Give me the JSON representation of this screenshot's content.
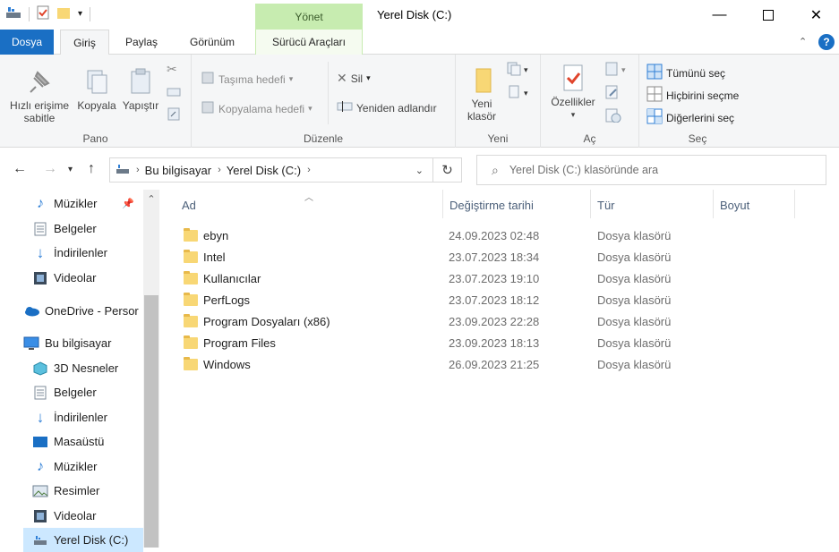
{
  "window": {
    "title": "Yerel Disk (C:)",
    "contextual_tab": "Yönet"
  },
  "tabs": {
    "file": "Dosya",
    "home": "Giriş",
    "share": "Paylaş",
    "view": "Görünüm",
    "drive_tools": "Sürücü Araçları"
  },
  "ribbon": {
    "pano": {
      "label": "Pano",
      "pin": "Hızlı erişime sabitle",
      "copy": "Kopyala",
      "paste": "Yapıştır"
    },
    "duzenle": {
      "label": "Düzenle",
      "move_to": "Taşıma hedefi",
      "copy_to": "Kopyalama hedefi",
      "delete": "Sil",
      "rename": "Yeniden adlandır"
    },
    "yeni": {
      "label": "Yeni",
      "new_folder": "Yeni klasör"
    },
    "ac": {
      "label": "Aç",
      "properties": "Özellikler"
    },
    "sec": {
      "label": "Seç",
      "select_all": "Tümünü seç",
      "select_none": "Hiçbirini seçme",
      "invert": "Diğerlerini seç"
    }
  },
  "address": {
    "crumbs": [
      "Bu bilgisayar",
      "Yerel Disk (C:)"
    ],
    "search_placeholder": "Yerel Disk (C:) klasöründe ara"
  },
  "sidebar": {
    "items": [
      {
        "label": "Müzikler",
        "icon": "music-icon"
      },
      {
        "label": "Belgeler",
        "icon": "document-icon"
      },
      {
        "label": "İndirilenler",
        "icon": "download-icon"
      },
      {
        "label": "Videolar",
        "icon": "video-icon"
      },
      {
        "label": "OneDrive - Persor",
        "icon": "cloud-icon"
      },
      {
        "label": "Bu bilgisayar",
        "icon": "computer-icon"
      },
      {
        "label": "3D Nesneler",
        "icon": "cube-icon"
      },
      {
        "label": "Belgeler",
        "icon": "document-icon"
      },
      {
        "label": "İndirilenler",
        "icon": "download-icon"
      },
      {
        "label": "Masaüstü",
        "icon": "desktop-icon"
      },
      {
        "label": "Müzikler",
        "icon": "music-icon"
      },
      {
        "label": "Resimler",
        "icon": "pictures-icon"
      },
      {
        "label": "Videolar",
        "icon": "video-icon"
      },
      {
        "label": "Yerel Disk (C:)",
        "icon": "drive-icon"
      }
    ]
  },
  "columns": {
    "name": "Ad",
    "date": "Değiştirme tarihi",
    "type": "Tür",
    "size": "Boyut"
  },
  "files": [
    {
      "name": "ebyn",
      "date": "24.09.2023 02:48",
      "type": "Dosya klasörü"
    },
    {
      "name": "Intel",
      "date": "23.07.2023 18:34",
      "type": "Dosya klasörü"
    },
    {
      "name": "Kullanıcılar",
      "date": "23.07.2023 19:10",
      "type": "Dosya klasörü"
    },
    {
      "name": "PerfLogs",
      "date": "23.07.2023 18:12",
      "type": "Dosya klasörü"
    },
    {
      "name": "Program Dosyaları (x86)",
      "date": "23.09.2023 22:28",
      "type": "Dosya klasörü"
    },
    {
      "name": "Program Files",
      "date": "23.09.2023 18:13",
      "type": "Dosya klasörü"
    },
    {
      "name": "Windows",
      "date": "26.09.2023 21:25",
      "type": "Dosya klasörü"
    }
  ],
  "colors": {
    "accent": "#1a6fc4",
    "manage_tab": "#c7ecb0",
    "folder": "#f8d775",
    "selected": "#cce8ff"
  }
}
